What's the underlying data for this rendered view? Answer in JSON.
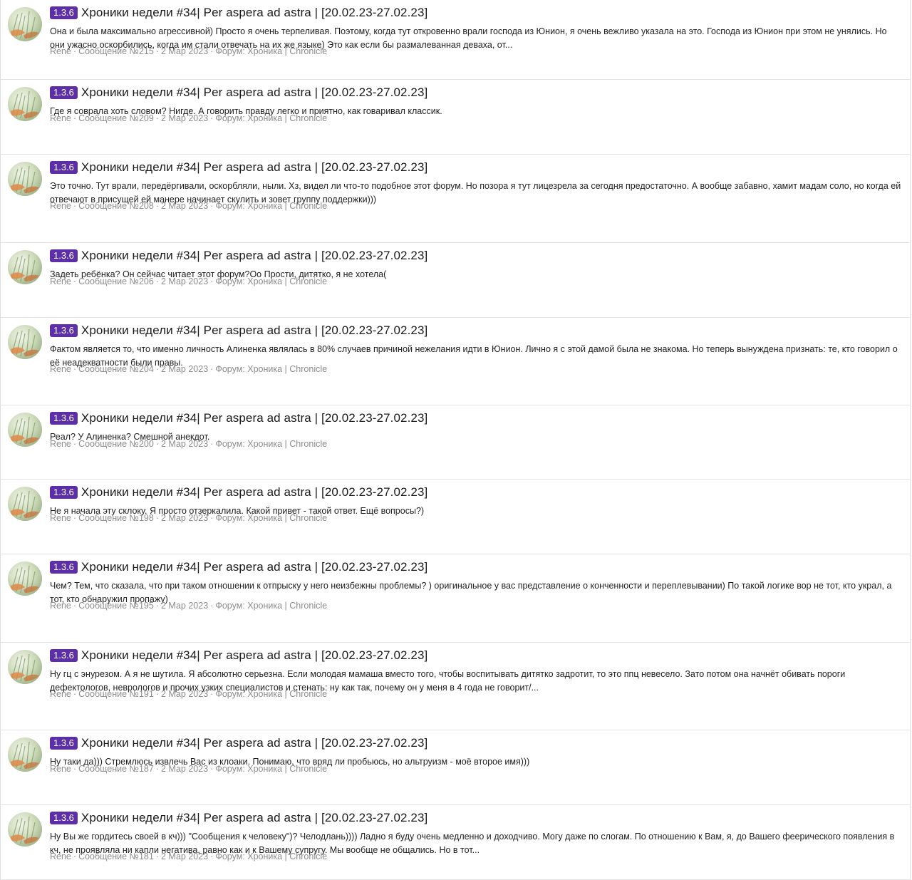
{
  "results": [
    {
      "badge": "1.3.6",
      "title": "Хроники недели #34| Per aspera ad astra | [20.02.23-27.02.23]",
      "snippet": "Она и была максимально агрессивной) Просто я очень терпеливая. Поэтому, когда тут откровенно врали господа из Юнион, я очень вежливо указала на это. Господа из Юнион при этом не унялись. Но они ужасно оскорбились, когда им стали отвечать на их же языке) Это как если бы размалеванная деваха, от...",
      "author": "Rene",
      "post": "Сообщение №215",
      "date": "2 Мар 2023",
      "forum": "Форум: Хроника | Chronicle"
    },
    {
      "badge": "1.3.6",
      "title": "Хроники недели #34| Per aspera ad astra | [20.02.23-27.02.23]",
      "snippet": "Где я соврала хоть словом? Нигде. А говорить правду легко и приятно, как говаривал классик.",
      "author": "Rene",
      "post": "Сообщение №209",
      "date": "2 Мар 2023",
      "forum": "Форум: Хроника | Chronicle"
    },
    {
      "badge": "1.3.6",
      "title": "Хроники недели #34| Per aspera ad astra | [20.02.23-27.02.23]",
      "snippet": "Это точно. Тут врали, передёргивали, оскорбляли, ныли. Хз, видел ли что-то подобное этот форум. Но позора я тут лицезрела за сегодня предостаточно. А вообще забавно, хамит мадам соло, но когда ей отвечают в присущей ей манере начинает скулить и зовет группу поддержки)))",
      "author": "Rene",
      "post": "Сообщение №208",
      "date": "2 Мар 2023",
      "forum": "Форум: Хроника | Chronicle"
    },
    {
      "badge": "1.3.6",
      "title": "Хроники недели #34| Per aspera ad astra | [20.02.23-27.02.23]",
      "snippet": "Задеть ребёнка? Он сейчас читает этот форум?Оо Прости, дитятко, я не хотела(",
      "author": "Rene",
      "post": "Сообщение №206",
      "date": "2 Мар 2023",
      "forum": "Форум: Хроника | Chronicle"
    },
    {
      "badge": "1.3.6",
      "title": "Хроники недели #34| Per aspera ad astra | [20.02.23-27.02.23]",
      "snippet": "Фактом является то, что именно личность Алиненка являлась в 80% случаев причиной нежелания идти в Юнион. Лично я с этой дамой была не знакома. Но теперь вынуждена признать: те, кто говорил о её неадекватности были правы.",
      "author": "Rene",
      "post": "Сообщение №204",
      "date": "2 Мар 2023",
      "forum": "Форум: Хроника | Chronicle"
    },
    {
      "badge": "1.3.6",
      "title": "Хроники недели #34| Per aspera ad astra | [20.02.23-27.02.23]",
      "snippet": "Реал? У Алиненка? Смешной анекдот.",
      "author": "Rene",
      "post": "Сообщение №200",
      "date": "2 Мар 2023",
      "forum": "Форум: Хроника | Chronicle"
    },
    {
      "badge": "1.3.6",
      "title": "Хроники недели #34| Per aspera ad astra | [20.02.23-27.02.23]",
      "snippet": "Не я начала эту склоку. Я просто отзеркалила. Какой привет - такой ответ. Ещё вопросы?)",
      "author": "Rene",
      "post": "Сообщение №198",
      "date": "2 Мар 2023",
      "forum": "Форум: Хроника | Chronicle"
    },
    {
      "badge": "1.3.6",
      "title": "Хроники недели #34| Per aspera ad astra | [20.02.23-27.02.23]",
      "snippet": "Чем? Тем, что сказала, что при таком отношении к отпрыску у него неизбежны проблемы? ) оригинальное у вас представление о конченности и переплевывании) По такой логике вор не тот, кто украл, а тот, кто обнаружил пропажу)",
      "author": "Rene",
      "post": "Сообщение №195",
      "date": "2 Мар 2023",
      "forum": "Форум: Хроника | Chronicle"
    },
    {
      "badge": "1.3.6",
      "title": "Хроники недели #34| Per aspera ad astra | [20.02.23-27.02.23]",
      "snippet": "Ну гц с энурезом. А я не шутила. Я абсолютно серьезна. Если молодая мамаша вместо того, чтобы воспитывать дитятко задротит, то это ппц невесело. Зато потом она начнёт обивать пороги дефектологов, неврологов и прочих узких специалистов и стенать: ну как так, почему он у меня в 4 года не говорит/...",
      "author": "Rene",
      "post": "Сообщение №191",
      "date": "2 Мар 2023",
      "forum": "Форум: Хроника | Chronicle"
    },
    {
      "badge": "1.3.6",
      "title": "Хроники недели #34| Per aspera ad astra | [20.02.23-27.02.23]",
      "snippet": "Ну таки да))) Стремлюсь извлечь Вас из клоаки. Понимаю, что вряд ли пробьюсь, но альтруизм - моё второе имя)))",
      "author": "Rene",
      "post": "Сообщение №187",
      "date": "2 Мар 2023",
      "forum": "Форум: Хроника | Chronicle"
    },
    {
      "badge": "1.3.6",
      "title": "Хроники недели #34| Per aspera ad astra | [20.02.23-27.02.23]",
      "snippet": "Ну Вы же гордитесь своей в кч))) \"Сообщения к человеку\")? Челодлань)))) Ладно я буду очень медленно и доходчиво. Могу даже по слогам. По отношению к Вам, я, до Вашего феерического появления в кч, не проявляла ни капли негатива, равно как и к Вашему супругу. Мы вообще не общались. Но в тот...",
      "author": "Rene",
      "post": "Сообщение №181",
      "date": "2 Мар 2023",
      "forum": "Форум: Хроника | Chronicle"
    }
  ],
  "colors": {
    "badge": "#5c2fa8",
    "meta": "#8c8c8c",
    "divider": "#e3e3e3"
  }
}
